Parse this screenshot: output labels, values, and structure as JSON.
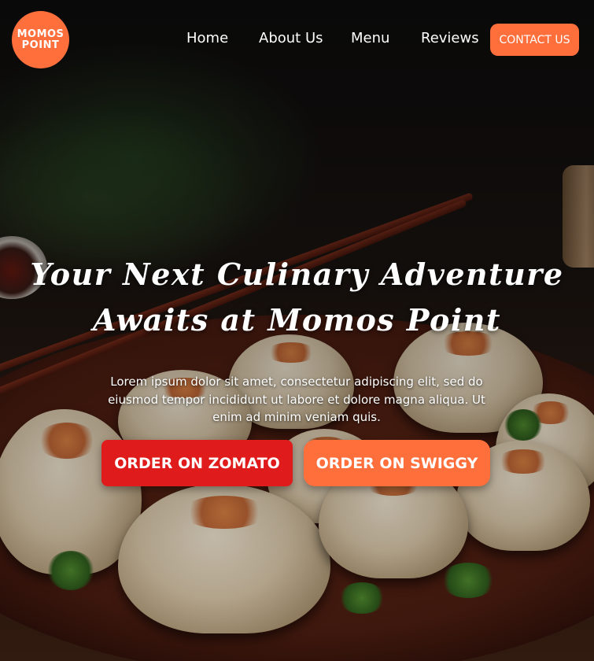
{
  "header": {
    "logo": {
      "line1": "MOMOS",
      "line2": "POINT"
    },
    "nav": [
      {
        "label": "Home"
      },
      {
        "label": "About Us"
      },
      {
        "label": "Menu"
      },
      {
        "label": "Reviews"
      }
    ],
    "contact_label": "CONTACT US"
  },
  "hero": {
    "title_line1": "Your Next Culinary Adventure",
    "title_line2": "Awaits at Momos Point",
    "description": "Lorem ipsum dolor sit amet, consectetur adipiscing elit, sed do eiusmod tempor incididunt ut labore et dolore magna aliqua. Ut enim ad minim veniam quis.",
    "buttons": {
      "zomato": "ORDER ON ZOMATO",
      "swiggy": "ORDER ON SWIGGY"
    }
  },
  "colors": {
    "accent": "#ff6f3c",
    "zomato_red": "#e01b1b",
    "text": "#ffffff"
  }
}
